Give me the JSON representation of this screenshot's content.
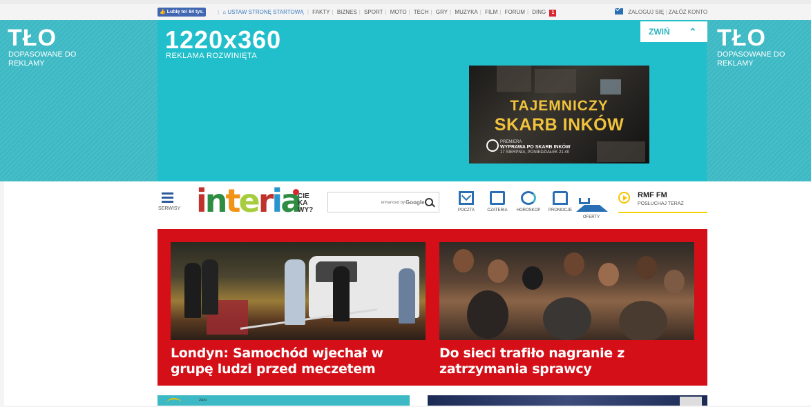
{
  "topbar": {
    "like_button": "Lubię to! 84 tys.",
    "set_homepage": "USTAW STRONĘ STARTOWĄ",
    "nav": [
      "FAKTY",
      "BIZNES",
      "SPORT",
      "MOTO",
      "TECH",
      "GRY",
      "MUZYKA",
      "FILM",
      "FORUM",
      "DING"
    ],
    "ding_badge": "1",
    "login": "ZALOGUJ SIĘ",
    "register": "ZAŁÓŻ KONTO"
  },
  "ad": {
    "bg_title": "TŁO",
    "bg_sub": "DOPASOWANE DO REKLAMY",
    "size": "1220x360",
    "type": "REKLAMA ROZWINIĘTA",
    "collapse": "ZWIŃ",
    "promo_line1": "TAJEMNICZY",
    "promo_line2": "SKARB INKÓW",
    "promo_small1": "PREMIERA",
    "promo_small2": "WYPRAWA PO SKARB INKÓW",
    "promo_small3": "17 SIERPNIA, PONIEDZIAŁEK 21:40",
    "colors": {
      "teal": "#20bfcb",
      "teal_side": "#3cb9c4",
      "gold": "#f0c23c"
    }
  },
  "header": {
    "menu_label": "SERWISY",
    "logo": "interia",
    "logo_tag": [
      "CIE",
      "KA",
      "WY?"
    ],
    "search": {
      "placeholder": "enhanced by",
      "brand": "Google"
    },
    "services": [
      {
        "label": "POCZTA",
        "icon": "mail-icon"
      },
      {
        "label": "CZATERIA",
        "icon": "chat-icon"
      },
      {
        "label": "HOROSKOP",
        "icon": "horoscope-icon"
      },
      {
        "label": "PROMOCJE",
        "icon": "promo-icon"
      },
      {
        "label": "OFERTY",
        "icon": "home-offer-icon"
      }
    ],
    "radio": {
      "name": "RMF FM",
      "sub": "POSŁUCHAJ TERAZ"
    }
  },
  "news": {
    "accent": "#d50f17",
    "stories": [
      {
        "headline": "Londyn: Samochód wjechał w grupę ludzi przed meczetem"
      },
      {
        "headline": "Do sieci trafiło nagranie z zatrzymania sprawcy"
      }
    ]
  },
  "bottom": {
    "left_small": "Jutro"
  }
}
